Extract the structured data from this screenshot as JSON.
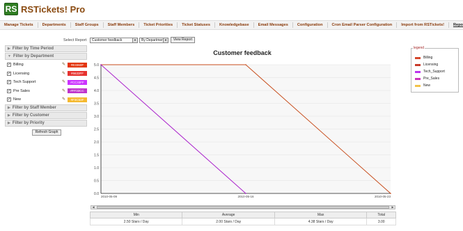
{
  "app": {
    "logo": "RS",
    "title": "RSTickets! Pro"
  },
  "nav": [
    {
      "label": "Manage Tickets",
      "active": false
    },
    {
      "label": "Departments",
      "active": false
    },
    {
      "label": "Staff Groups",
      "active": false
    },
    {
      "label": "Staff Members",
      "active": false
    },
    {
      "label": "Ticket Priorities",
      "active": false
    },
    {
      "label": "Ticket Statuses",
      "active": false
    },
    {
      "label": "Knowledgebase",
      "active": false
    },
    {
      "label": "Email Messages",
      "active": false
    },
    {
      "label": "Configuration",
      "active": false
    },
    {
      "label": "Cron Email Parser Configuration",
      "active": false
    },
    {
      "label": "Import from RSTickets!",
      "active": false
    },
    {
      "label": "Reports",
      "active": true
    }
  ],
  "controls": {
    "select_label": "Select Report",
    "report_value": "Customer feedback",
    "group_value": "By Department",
    "view_button": "View Report"
  },
  "sidebar": {
    "time_period": "Filter by Time Period",
    "department": "Filter by Department",
    "staff_member": "Filter by Staff Member",
    "customer": "Filter by Customer",
    "priority": "Filter by Priority",
    "refresh": "Refresh Graph",
    "departments": [
      {
        "name": "Billing",
        "checked": true,
        "color": "#E3360F",
        "color_label": "#E3360F"
      },
      {
        "name": "Licensing",
        "checked": true,
        "color": "#E6332F",
        "color_label": "#6633FF"
      },
      {
        "name": "Tech Support",
        "checked": true,
        "color": "#CC33FF",
        "color_label": "#CC33FF"
      },
      {
        "name": "Pre Sales",
        "checked": true,
        "color": "#BF33CC",
        "color_label": "#FF33CC"
      },
      {
        "name": "New",
        "checked": true,
        "color": "#F5B92F",
        "color_label": "#F3C53F"
      }
    ]
  },
  "legend": {
    "title": "legend",
    "items": [
      {
        "label": "Billing",
        "color": "#d4462b"
      },
      {
        "label": "Licensing",
        "color": "#c83a2a"
      },
      {
        "label": "Tech_Support",
        "color": "#bb33ee"
      },
      {
        "label": "Pre_Sales",
        "color": "#cc33bb"
      },
      {
        "label": "New",
        "color": "#f2c24a"
      }
    ]
  },
  "chart_data": {
    "type": "line",
    "title": "Customer feedback",
    "xlabel": "",
    "ylabel": "",
    "x": [
      "2010-05-09",
      "2010-05-16",
      "2010-05-23"
    ],
    "ylim": [
      0,
      5
    ],
    "yticks": [
      "0.0",
      "0.5",
      "1.0",
      "1.5",
      "2.0",
      "2.5",
      "3.0",
      "3.5",
      "4.0",
      "4.5",
      "5.0"
    ],
    "grid": true,
    "series": [
      {
        "name": "Billing",
        "color": "#c84e1e",
        "values": [
          5,
          5,
          0
        ]
      },
      {
        "name": "Tech_Support",
        "color": "#aa22cc",
        "values": [
          5,
          0,
          null
        ]
      }
    ]
  },
  "stats": {
    "headers": [
      "Min",
      "Average",
      "Max",
      "Total"
    ],
    "row": [
      "2.50 Stars / Day",
      "2.00 Stars / Day",
      "4.38 Stars / Day",
      "3.00"
    ]
  }
}
